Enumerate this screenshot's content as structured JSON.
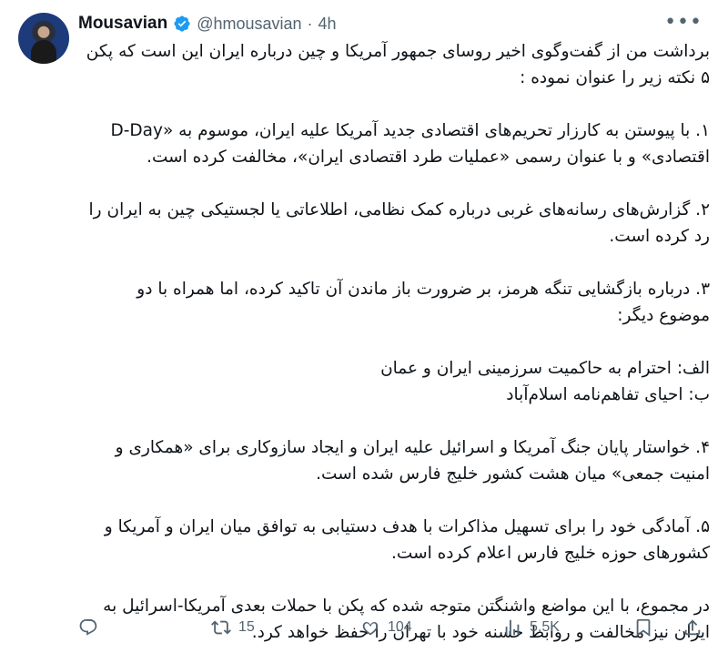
{
  "author": {
    "name": "Mousavian",
    "handle": "@hmousavian",
    "separator": "·",
    "time": "4h"
  },
  "tweet": {
    "intro_1": "برداشت من از گفت‌وگوی اخیر روسای جمهور آمریکا و چین درباره ایران این است که پکن",
    "intro_2": "۵ نکته زیر را عنوان نموده :",
    "p1_a": "۱. با پیوستن به کارزار تحریم‌های اقتصادی جدید آمریکا علیه ایران، موسوم به «D-Day",
    "p1_b": "اقتصادی» و با عنوان رسمی «عملیات طرد اقتصادی ایران»، مخالفت کرده است.",
    "p2_a": "۲. گزارش‌های رسانه‌های غربی درباره کمک نظامی، اطلاعاتی یا لجستیکی چین به ایران را",
    "p2_b": "رد کرده است.",
    "p3_a": "۳. درباره بازگشایی تنگه هرمز، بر ضرورت باز ماندن آن تاکید کرده، اما همراه با دو",
    "p3_b": "موضوع دیگر:",
    "p3_alef": "الف: احترام به حاکمیت سرزمینی ایران و عمان",
    "p3_be": "ب: احیای تفاهم‌نامه اسلام‌آباد",
    "p4_a": "۴. خواستار پایان جنگ آمریکا و اسرائیل علیه ایران و ایجاد سازوکاری برای «همکاری و",
    "p4_b": "امنیت جمعی» میان هشت کشور خلیج فارس شده است.",
    "p5_a": "۵. آمادگی خود را برای تسهیل مذاکرات با هدف دستیابی به توافق میان ایران و آمریکا و",
    "p5_b": "کشورهای حوزه خلیج فارس اعلام کرده است.",
    "end_a": "در مجموع، با این مواضع واشنگتن متوجه شده که پکن با حملات بعدی آمریکا-اسرائیل به",
    "end_b": "ایران نیز مخالفت و روابط حسنه خود با تهران را حفظ خواهد کرد."
  },
  "actions": {
    "retweets": "15",
    "likes": "104",
    "views": "5.5K"
  },
  "icons": {
    "verified": "verified-badge-icon",
    "more": "more-options-icon",
    "reply": "reply-icon",
    "retweet": "retweet-icon",
    "like": "heart-icon",
    "views": "views-chart-icon",
    "bookmark": "bookmark-icon",
    "share": "share-icon"
  },
  "colors": {
    "verified": "#1d9bf0",
    "secondary_text": "#536471",
    "text": "#0f1419"
  }
}
